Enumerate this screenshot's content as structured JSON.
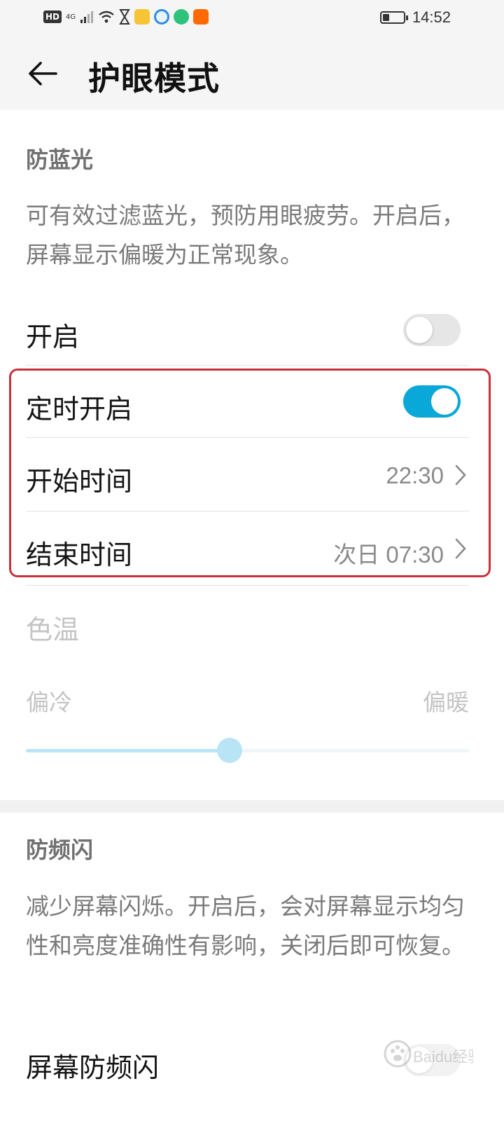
{
  "status_bar": {
    "network": "HD",
    "signal": "4G",
    "time": "14:52"
  },
  "app_bar": {
    "title": "护眼模式",
    "back_icon": "arrow-left-icon"
  },
  "blue_light": {
    "section_title": "防蓝光",
    "description": "可有效过滤蓝光，预防用眼疲劳。开启后，屏幕显示偏暖为正常现象。",
    "enable_label": "开启",
    "enable_on": false,
    "schedule_label": "定时开启",
    "schedule_on": true,
    "start_label": "开始时间",
    "start_value": "22:30",
    "end_label": "结束时间",
    "end_value": "次日 07:30",
    "color_temp_label": "色温",
    "cool_label": "偏冷",
    "warm_label": "偏暖",
    "color_temp_level": 0.46
  },
  "flicker": {
    "section_title": "防频闪",
    "description": "减少屏幕闪烁。开启后，会对屏幕显示均匀性和亮度准确性有影响，关闭后即可恢复。",
    "row_label": "屏幕防频闪"
  },
  "watermark": {
    "text": "Baidu经验"
  },
  "colors": {
    "accent": "#0aa7d9",
    "highlight": "#c9303b",
    "slider_disabled": "#b8e4f5"
  }
}
